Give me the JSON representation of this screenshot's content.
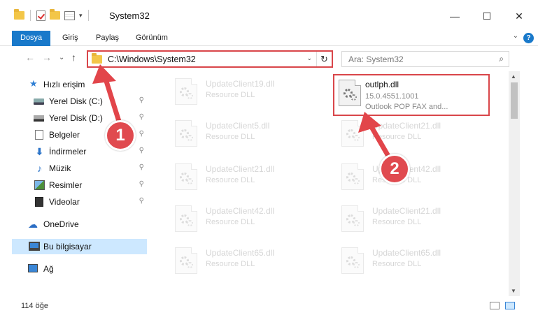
{
  "window": {
    "title": "System32",
    "minimize": "—",
    "maximize": "☐",
    "close": "✕"
  },
  "ribbon": {
    "tabs": [
      "Dosya",
      "Giriş",
      "Paylaş",
      "Görünüm"
    ],
    "expand": "⌄",
    "help": "?"
  },
  "nav": {
    "back": "←",
    "forward": "→",
    "recent": "⌄",
    "up": "↑",
    "address": "C:\\Windows\\System32",
    "address_dropdown": "⌄",
    "refresh": "↻",
    "search_placeholder": "Ara: System32",
    "search_icon": "⌕"
  },
  "sidebar": {
    "quick_access": "Hızlı erişim",
    "items": [
      {
        "label": "Yerel Disk (C:)",
        "icon": "drive-icon",
        "pinned": true
      },
      {
        "label": "Yerel Disk (D:)",
        "icon": "drive-icon",
        "pinned": true
      },
      {
        "label": "Belgeler",
        "icon": "documents-icon",
        "pinned": true
      },
      {
        "label": "İndirmeler",
        "icon": "downloads-icon",
        "pinned": true
      },
      {
        "label": "Müzik",
        "icon": "music-icon",
        "pinned": true
      },
      {
        "label": "Resimler",
        "icon": "pictures-icon",
        "pinned": true
      },
      {
        "label": "Videolar",
        "icon": "videos-icon",
        "pinned": true
      }
    ],
    "onedrive": "OneDrive",
    "this_pc": "Bu bilgisayar",
    "network": "Ağ",
    "pin_glyph": "📌"
  },
  "files": {
    "left_column": [
      {
        "name": "UpdateClient19.dll",
        "type": "Resource DLL"
      },
      {
        "name": "UpdateClient5.dll",
        "type": "Resource DLL"
      },
      {
        "name": "UpdateClient21.dll",
        "type": "Resource DLL"
      },
      {
        "name": "UpdateClient42.dll",
        "type": "Resource DLL"
      },
      {
        "name": "UpdateClient65.dll",
        "type": "Resource DLL"
      }
    ],
    "right_column": [
      {
        "name": "outlph.dll",
        "version": "15.0.4551.1001",
        "type": "Outlook POP FAX and..."
      },
      {
        "name": "UpdateClient21.dll",
        "type": "Resource DLL"
      },
      {
        "name": "UpdateClient42.dll",
        "type": "Resource DLL"
      },
      {
        "name": "UpdateClient21.dll",
        "type": "Resource DLL"
      },
      {
        "name": "UpdateClient65.dll",
        "type": "Resource DLL"
      }
    ]
  },
  "status": {
    "count": "114 öğe"
  },
  "callouts": {
    "one": "1",
    "two": "2",
    "color": "#e2454a"
  },
  "colors": {
    "accent": "#1979ca",
    "highlight_border": "#d9464a",
    "selected_bg": "#cde8ff"
  }
}
